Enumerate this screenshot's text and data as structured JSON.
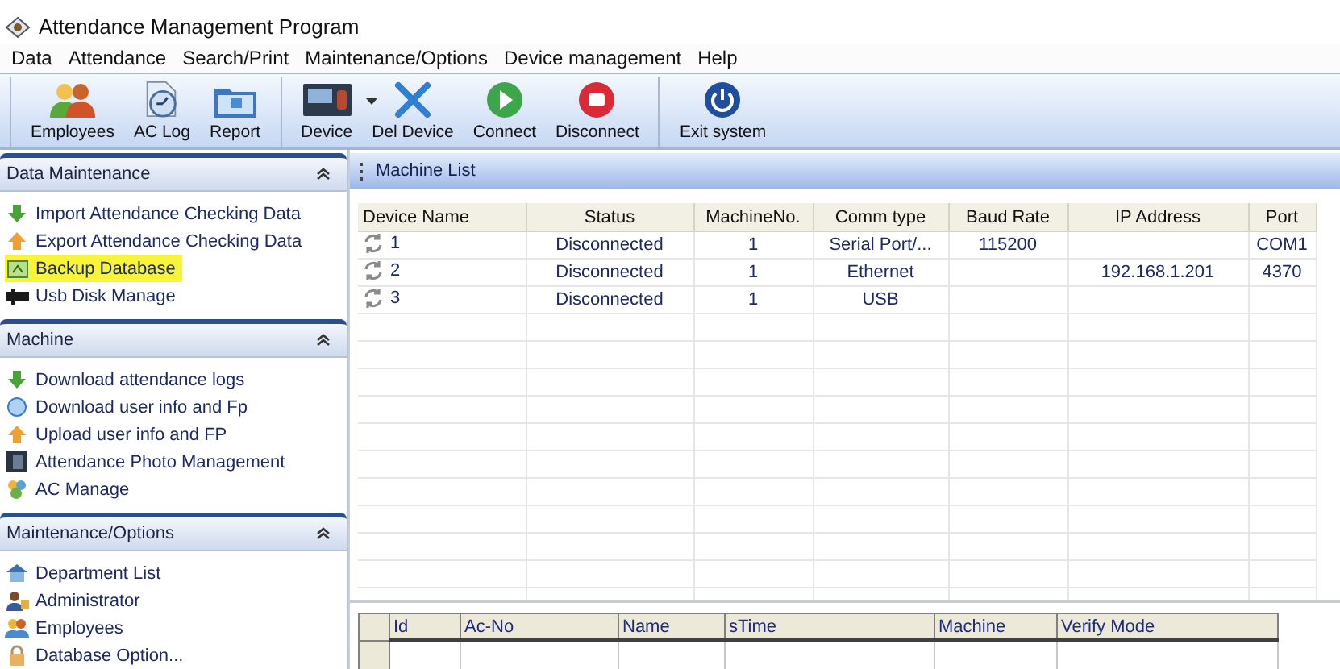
{
  "window": {
    "title": "Attendance Management Program"
  },
  "menu": [
    "Data",
    "Attendance",
    "Search/Print",
    "Maintenance/Options",
    "Device management",
    "Help"
  ],
  "toolbar": [
    [
      {
        "label": "Employees",
        "dropdown": false
      },
      {
        "label": "AC Log",
        "dropdown": false
      },
      {
        "label": "Report",
        "dropdown": false
      }
    ],
    [
      {
        "label": "Device",
        "dropdown": true
      },
      {
        "label": "Del Device",
        "dropdown": false
      },
      {
        "label": "Connect",
        "dropdown": false
      },
      {
        "label": "Disconnect",
        "dropdown": false
      }
    ],
    [
      {
        "label": "Exit system",
        "dropdown": false
      }
    ]
  ],
  "sidebar": [
    {
      "title": "Data Maintenance",
      "expanded": true,
      "items": [
        {
          "label": "Import Attendance Checking Data",
          "highlighted": false
        },
        {
          "label": "Export Attendance Checking Data",
          "highlighted": false
        },
        {
          "label": "Backup Database",
          "highlighted": true
        },
        {
          "label": "Usb Disk Manage",
          "highlighted": false
        }
      ]
    },
    {
      "title": "Machine",
      "expanded": true,
      "items": [
        {
          "label": "Download attendance logs",
          "highlighted": false
        },
        {
          "label": "Download user info and Fp",
          "highlighted": false
        },
        {
          "label": "Upload user info and FP",
          "highlighted": false
        },
        {
          "label": "Attendance Photo Management",
          "highlighted": false
        },
        {
          "label": "AC Manage",
          "highlighted": false
        }
      ]
    },
    {
      "title": "Maintenance/Options",
      "expanded": true,
      "items": [
        {
          "label": "Department List",
          "highlighted": false
        },
        {
          "label": "Administrator",
          "highlighted": false
        },
        {
          "label": "Employees",
          "highlighted": false
        },
        {
          "label": "Database Option...",
          "highlighted": false
        }
      ]
    }
  ],
  "machine_list": {
    "title": "Machine List",
    "columns": [
      "Device Name",
      "Status",
      "MachineNo.",
      "Comm type",
      "Baud Rate",
      "IP Address",
      "Port"
    ],
    "rows": [
      [
        "1",
        "Disconnected",
        "1",
        "Serial Port/...",
        "115200",
        null,
        "COM1"
      ],
      [
        "2",
        "Disconnected",
        "1",
        "Ethernet",
        null,
        "192.168.1.201",
        "4370"
      ],
      [
        "3",
        "Disconnected",
        "1",
        "USB",
        null,
        null,
        null
      ]
    ]
  },
  "records": {
    "columns": [
      "Id",
      "Ac-No",
      "Name",
      "sTime",
      "Machine",
      "Verify Mode"
    ]
  }
}
